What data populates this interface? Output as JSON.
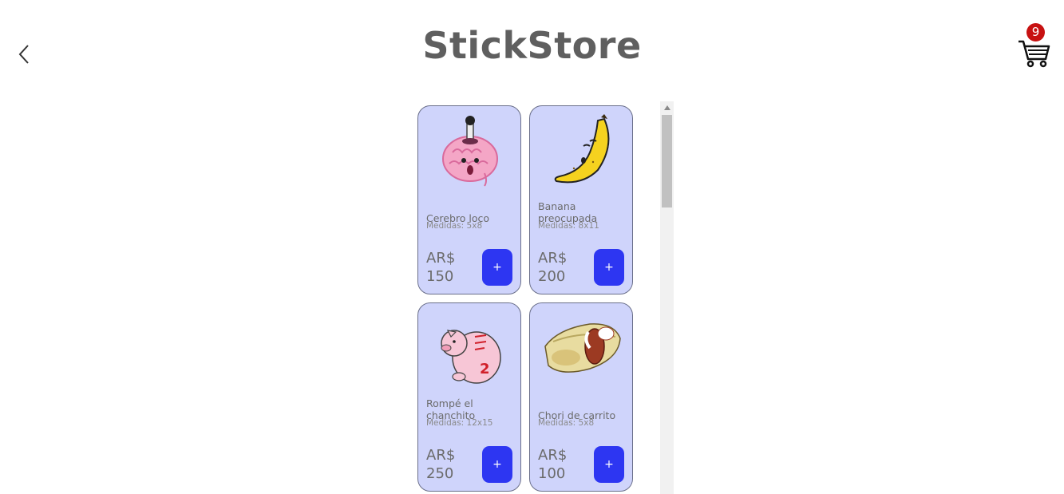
{
  "header": {
    "title": "StickStore",
    "back_icon": "chevron-left-icon",
    "cart_icon": "shopping-cart-icon",
    "cart_count": "9",
    "badge_color": "#c71111"
  },
  "products": [
    {
      "name": "Cerebro loco",
      "size": "Medidas: 5x8",
      "currency": "AR$",
      "price": "150",
      "add_label": "+",
      "image": "brain-sticker"
    },
    {
      "name": "Banana preocupada",
      "size": "Medidas: 8x11",
      "currency": "AR$",
      "price": "200",
      "add_label": "+",
      "image": "banana-sticker"
    },
    {
      "name": "Rompé el chanchito",
      "size": "Medidas: 12x15",
      "currency": "AR$",
      "price": "250",
      "add_label": "+",
      "image": "piggy-bank-sticker"
    },
    {
      "name": "Chori de carrito",
      "size": "Medidas: 5x8",
      "currency": "AR$",
      "price": "100",
      "add_label": "+",
      "image": "choripan-sticker"
    }
  ],
  "colors": {
    "card_bg": "#cfd4fb",
    "add_button": "#2d36f2",
    "title": "#5f5f5f"
  }
}
